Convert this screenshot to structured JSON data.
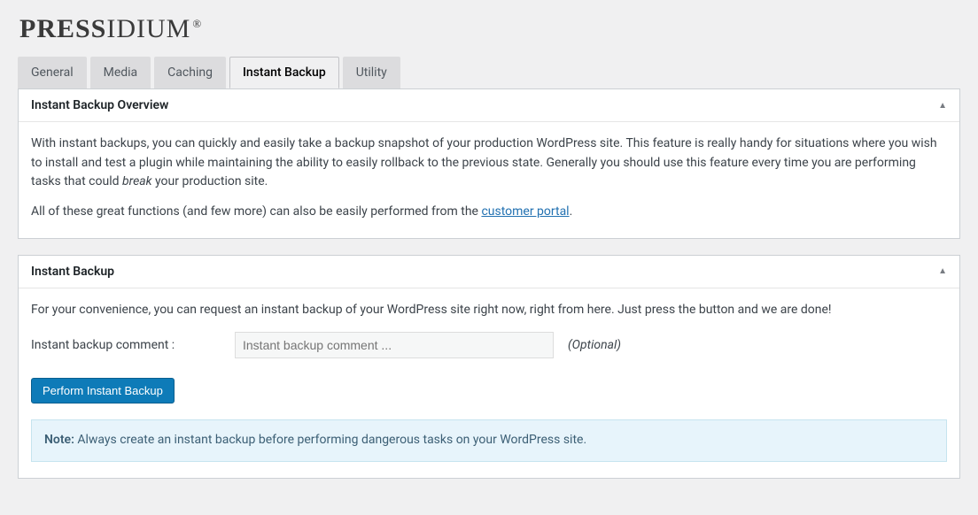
{
  "brand": {
    "name_bold": "PRESS",
    "name_light": "IDIUM",
    "reg": "®"
  },
  "tabs": {
    "items": [
      {
        "label": "General"
      },
      {
        "label": "Media"
      },
      {
        "label": "Caching"
      },
      {
        "label": "Instant Backup"
      },
      {
        "label": "Utility"
      }
    ],
    "active_index": 3
  },
  "overview_panel": {
    "title": "Instant Backup Overview",
    "p1_a": "With instant backups, you can quickly and easily take a backup snapshot of your production WordPress site. This feature is really handy for situations where you wish to install and test a plugin while maintaining the ability to easily rollback to the previous state. Generally you should use this feature every time you are performing tasks that could ",
    "p1_em": "break",
    "p1_b": " your production site.",
    "p2_a": "All of these great functions (and few more) can also be easily performed from the ",
    "p2_link": "customer portal",
    "p2_b": "."
  },
  "backup_panel": {
    "title": "Instant Backup",
    "intro": "For your convenience, you can request an instant backup of your WordPress site right now, right from here. Just press the button and we are done!",
    "comment_label": "Instant backup comment :",
    "comment_placeholder": "Instant backup comment ...",
    "comment_value": "",
    "optional": "(Optional)",
    "button": "Perform Instant Backup",
    "note_label": "Note:",
    "note_text": " Always create an instant backup before performing dangerous tasks on your WordPress site."
  }
}
